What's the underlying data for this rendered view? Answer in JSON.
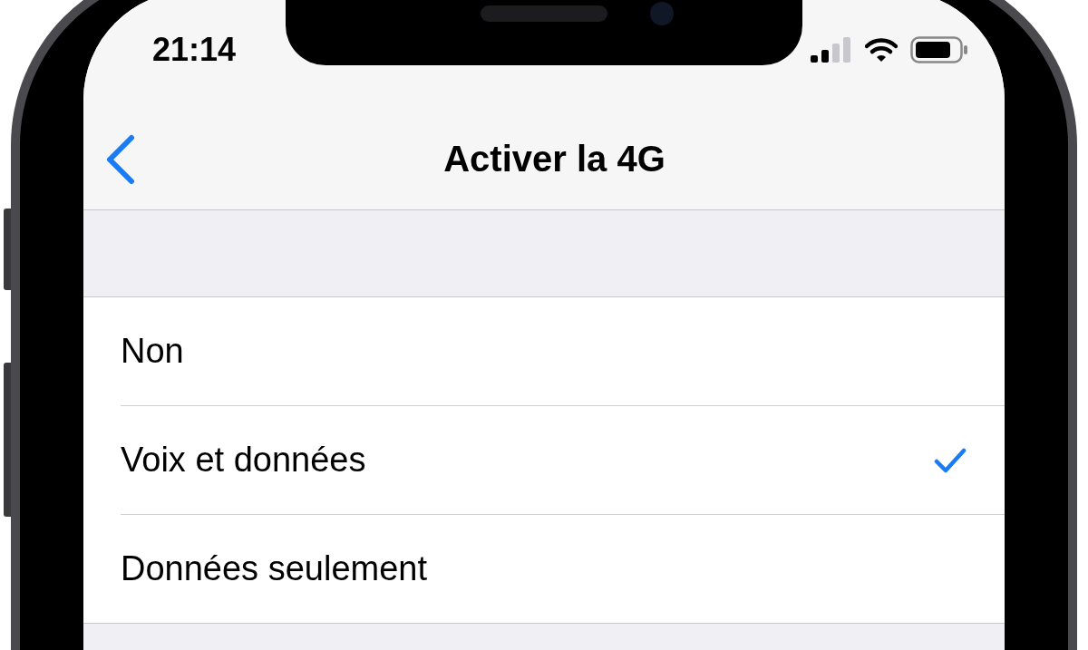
{
  "status_bar": {
    "time": "21:14"
  },
  "nav_bar": {
    "title": "Activer la 4G"
  },
  "options": [
    {
      "label": "Non",
      "selected": false
    },
    {
      "label": "Voix et données",
      "selected": true
    },
    {
      "label": "Données seulement",
      "selected": false
    }
  ]
}
